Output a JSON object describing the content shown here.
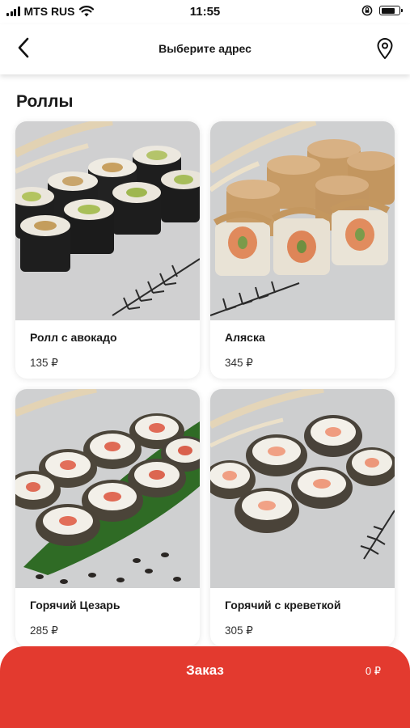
{
  "status_bar": {
    "carrier": "MTS RUS",
    "time": "11:55",
    "icons": [
      "signal-icon",
      "wifi-icon",
      "orientation-lock-icon",
      "battery-icon"
    ],
    "battery_level_percent": 80
  },
  "header": {
    "title": "Выберите адрес",
    "back_icon": "chevron-left-icon",
    "location_icon": "map-pin-icon"
  },
  "section": {
    "title": "Роллы"
  },
  "products": [
    {
      "name": "Ролл с авокадо",
      "price": "135 ₽",
      "image": "avocado-roll-photo"
    },
    {
      "name": "Аляска",
      "price": "345 ₽",
      "image": "alaska-roll-photo"
    },
    {
      "name": "Горячий Цезарь",
      "price": "285 ₽",
      "image": "hot-caesar-roll-photo"
    },
    {
      "name": "Горячий с креветкой",
      "price": "305 ₽",
      "image": "hot-shrimp-roll-photo"
    }
  ],
  "order": {
    "label": "Заказ",
    "total": "0 ₽"
  },
  "colors": {
    "accent": "#e33a2f",
    "text": "#1a1a1a",
    "background": "#ffffff"
  }
}
